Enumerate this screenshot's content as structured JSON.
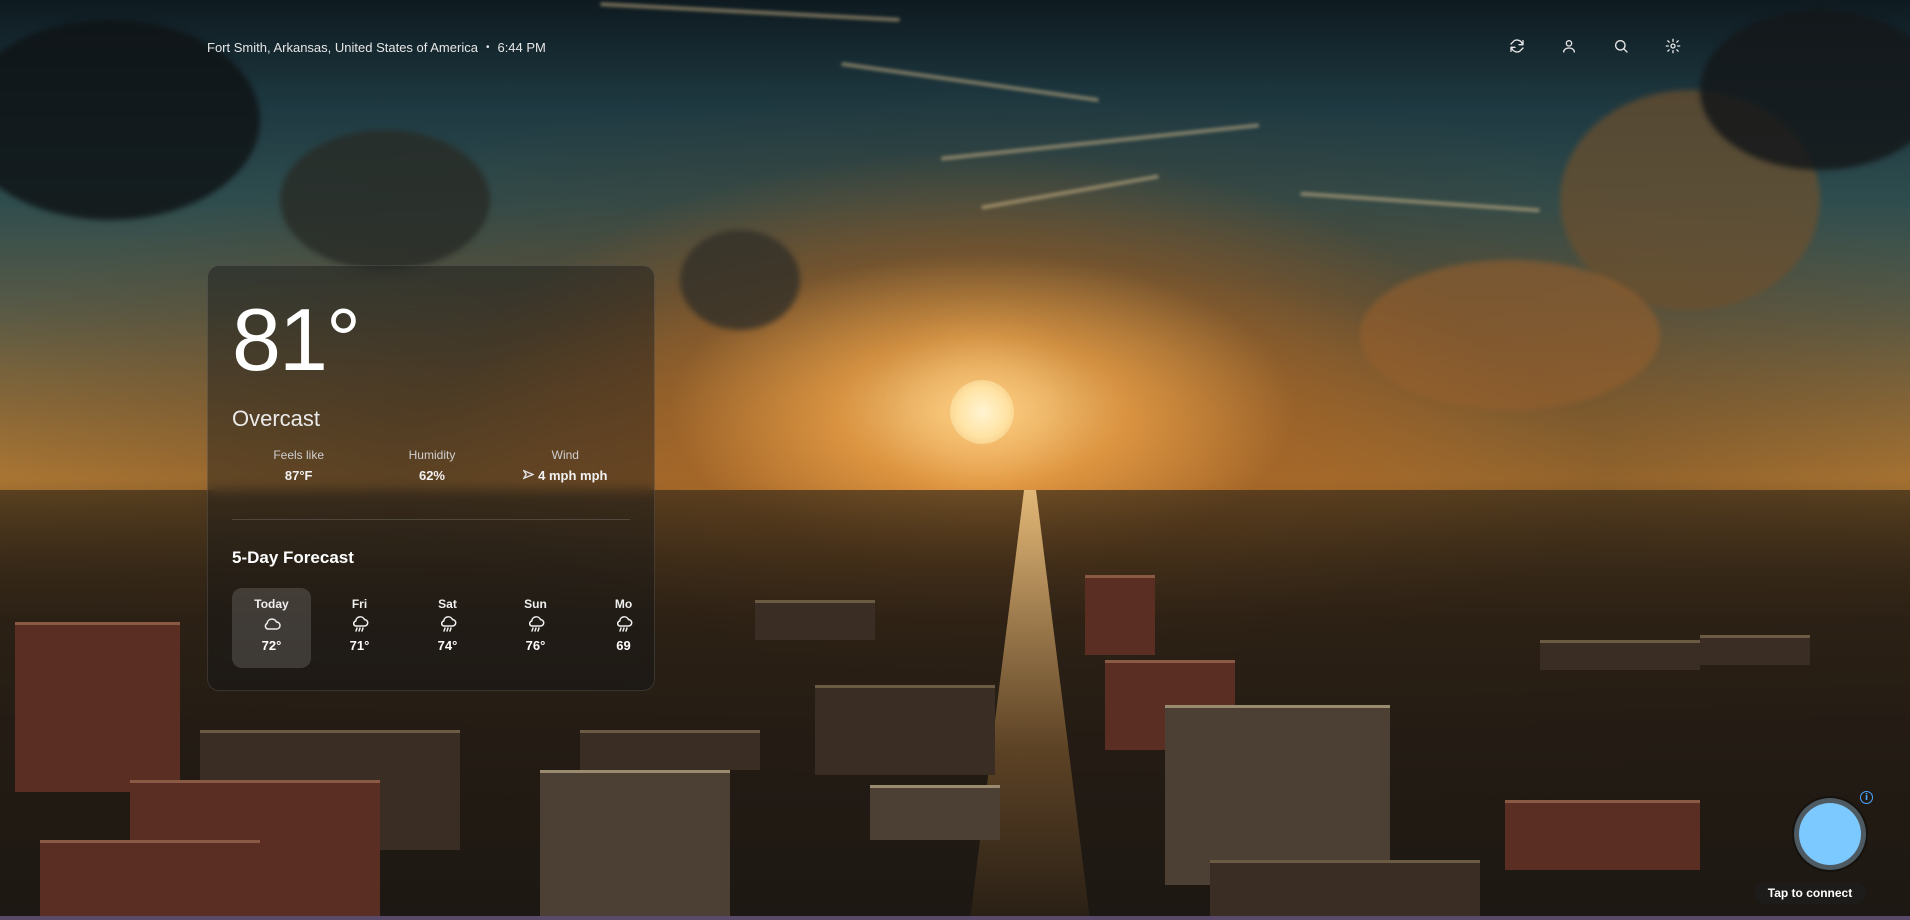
{
  "header": {
    "location": "Fort Smith, Arkansas, United States of America",
    "separator": "•",
    "time": "6:44 PM",
    "icons": [
      "refresh-icon",
      "user-icon",
      "search-icon",
      "settings-icon"
    ]
  },
  "current": {
    "temperature": "81°",
    "condition": "Overcast",
    "stats": [
      {
        "label": "Feels like",
        "value": "87°F"
      },
      {
        "label": "Humidity",
        "value": "62%"
      },
      {
        "label": "Wind",
        "value": "4 mph mph",
        "icon": "wind-direction-icon"
      }
    ]
  },
  "forecast": {
    "title": "5-Day Forecast",
    "days": [
      {
        "day": "Today",
        "icon": "cloud-icon",
        "temp": "72°"
      },
      {
        "day": "Fri",
        "icon": "rain-cloud-icon",
        "temp": "71°"
      },
      {
        "day": "Sat",
        "icon": "rain-cloud-icon",
        "temp": "74°"
      },
      {
        "day": "Sun",
        "icon": "rain-cloud-icon",
        "temp": "76°"
      },
      {
        "day": "Mo",
        "icon": "rain-cloud-icon",
        "temp": "69"
      }
    ]
  },
  "connect": {
    "label": "Tap to connect",
    "info_badge": "i",
    "orb_color": "#7cc9ff"
  },
  "theme": {
    "card_background": "rgba(20,22,24,0.42)",
    "text_color": "#ffffff"
  }
}
